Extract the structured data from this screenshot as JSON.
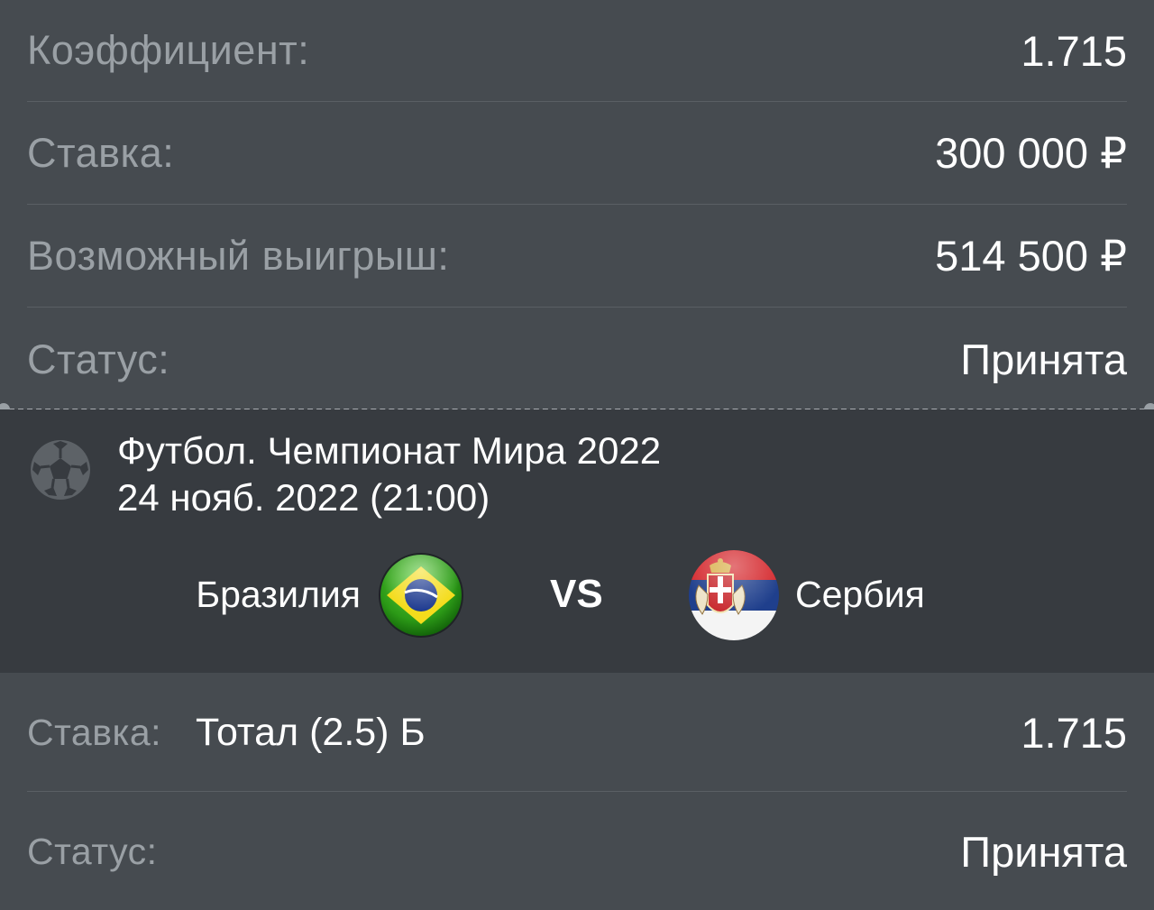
{
  "summary": {
    "rows": [
      {
        "label": "Коэффициент:",
        "value": "1.715"
      },
      {
        "label": "Ставка:",
        "value": "300 000 ₽"
      },
      {
        "label": "Возможный выигрыш:",
        "value": "514 500 ₽"
      },
      {
        "label": "Статус:",
        "value": "Принята"
      }
    ]
  },
  "event": {
    "sport_icon": "soccer-ball-icon",
    "title": "Футбол. Чемпионат Мира 2022",
    "date": "24 нояб. 2022 (21:00)",
    "home_team": {
      "name": "Бразилия",
      "flag_icon": "brazil-flag-icon"
    },
    "vs_label": "VS",
    "away_team": {
      "name": "Сербия",
      "flag_icon": "serbia-flag-icon"
    }
  },
  "bet": {
    "stake_label": "Ставка:",
    "market": "Тотал (2.5) Б",
    "odds": "1.715",
    "status_label": "Статус:",
    "status_value": "Принята"
  },
  "colors": {
    "background": "#464b50",
    "event_background": "#373b40",
    "label": "#9aa0a5",
    "value": "#ffffff",
    "divider": "#5a5f64"
  }
}
